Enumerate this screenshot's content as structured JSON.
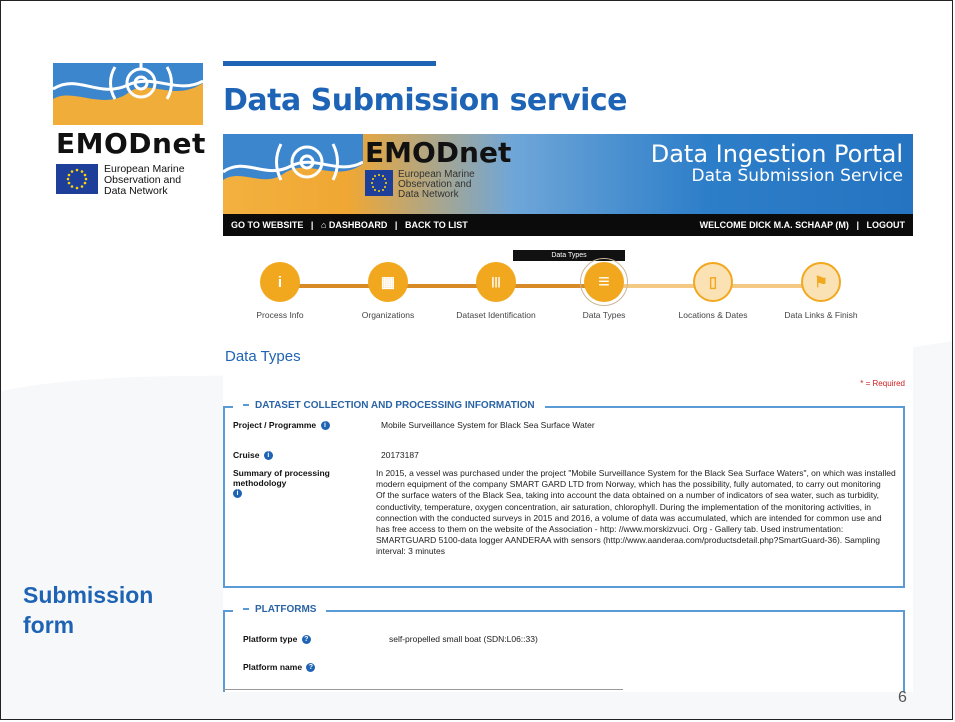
{
  "slide": {
    "title": "Data Submission service",
    "side_label_1": "Submission",
    "side_label_2": "form",
    "page_number": "6",
    "logo": {
      "word": "EMODnet",
      "sub": [
        "European Marine",
        "Observation and",
        "Data Network"
      ]
    }
  },
  "portal": {
    "banner": {
      "word": "EMODnet",
      "sub": [
        "European Marine",
        "Observation and",
        "Data Network"
      ],
      "title": "Data Ingestion Portal",
      "subtitle": "Data Submission Service"
    },
    "nav": {
      "go_to_website": "GO TO WEBSITE",
      "dashboard": "DASHBOARD",
      "back_to_list": "BACK TO LIST",
      "welcome": "WELCOME DICK M.A. SCHAAP (M)",
      "logout": "LOGOUT",
      "sep": "|"
    },
    "tooltip": "Data Types",
    "steps": [
      {
        "label": "Process Info",
        "icon": "info-icon",
        "glyph": "i",
        "state": "done"
      },
      {
        "label": "Organizations",
        "icon": "building-icon",
        "glyph": "▦",
        "state": "done"
      },
      {
        "label": "Dataset Identification",
        "icon": "barcode-icon",
        "glyph": "|||",
        "state": "done"
      },
      {
        "label": "Data Types",
        "icon": "list-icon",
        "glyph": "≡",
        "state": "active"
      },
      {
        "label": "Locations & Dates",
        "icon": "map-icon",
        "glyph": "▯",
        "state": "pending"
      },
      {
        "label": "Data Links & Finish",
        "icon": "flag-icon",
        "glyph": "⚑",
        "state": "pending"
      }
    ],
    "section_title": "Data Types",
    "required_note": "* = Required",
    "dataset": {
      "legend": "DATASET COLLECTION AND PROCESSING INFORMATION",
      "project_label": "Project / Programme",
      "project_value": "Mobile Surveillance System for Black Sea Surface Water",
      "cruise_label": "Cruise",
      "cruise_value": "20173187",
      "summary_label": "Summary of processing methodology",
      "summary_lines": [
        "In 2015, a vessel was purchased under the project \"Mobile Surveillance System for the Black Sea Surface Waters\", on which was installed",
        "modern equipment of the company SMART GARD LTD from Norway, which has the possibility, fully automated, to carry out monitoring",
        "Of the surface waters of the Black Sea, taking into account the data obtained on a number of indicators of sea water, such as turbidity,",
        "conductivity, temperature, oxygen concentration, air saturation, chlorophyll. During the implementation of the monitoring activities, in",
        "connection with the conducted surveys in 2015 and 2016, a volume of data was accumulated, which are intended for common use and",
        "has free access to them on the website of the Association - http: //www.morskizvuci. Org - Gallery tab. Used instrumentation:",
        "SMARTGUARD 5100-data logger AANDERAA with sensors (http://www.aanderaa.com/productsdetail.php?SmartGuard-36). Sampling",
        "interval: 3 minutes"
      ]
    },
    "platforms": {
      "legend": "PLATFORMS",
      "type_label": "Platform type",
      "type_value": "self-propelled small boat (SDN:L06::33)",
      "name_label": "Platform name"
    }
  },
  "colors": {
    "brand_blue": "#1d63b6",
    "accent_orange": "#f2a81e",
    "nav_black": "#0b0b0b"
  }
}
